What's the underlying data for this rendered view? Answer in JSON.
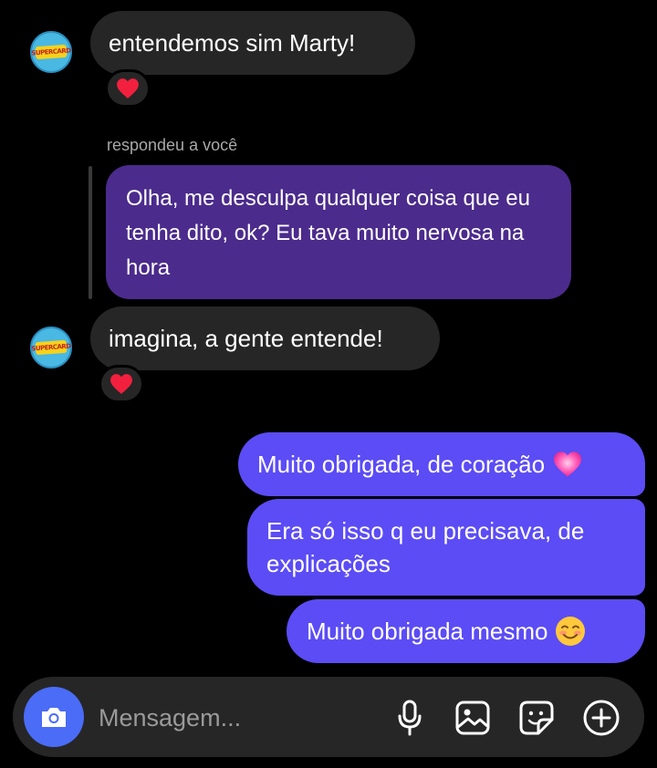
{
  "thread": {
    "messages_in": [
      {
        "text": "entendemos sim Marty!",
        "reaction": "❤️"
      },
      {
        "text": "imagina, a gente entende!",
        "reaction": "❤️"
      }
    ],
    "reply": {
      "label": "respondeu a você",
      "text": "Olha, me desculpa qualquer coisa que eu tenha dito, ok? Eu tava muito nervosa na hora"
    },
    "messages_out": [
      {
        "text": "Muito obrigada, de coração",
        "emoji": "💗"
      },
      {
        "text": "Era só isso q eu precisava, de explicações"
      },
      {
        "text": "Muito obrigada mesmo",
        "emoji": "☺️"
      }
    ],
    "avatar_logo_text": "SUPERCARD"
  },
  "composer": {
    "placeholder": "Mensagem...",
    "icons": [
      "camera-icon",
      "microphone-icon",
      "gallery-icon",
      "sticker-icon",
      "plus-icon"
    ]
  },
  "colors": {
    "incoming_bubble": "#262626",
    "reply_bubble": "#4b2b8c",
    "outgoing_bubble": "#5b4cf5",
    "camera_button": "#4a6cf7",
    "background": "#000000"
  }
}
